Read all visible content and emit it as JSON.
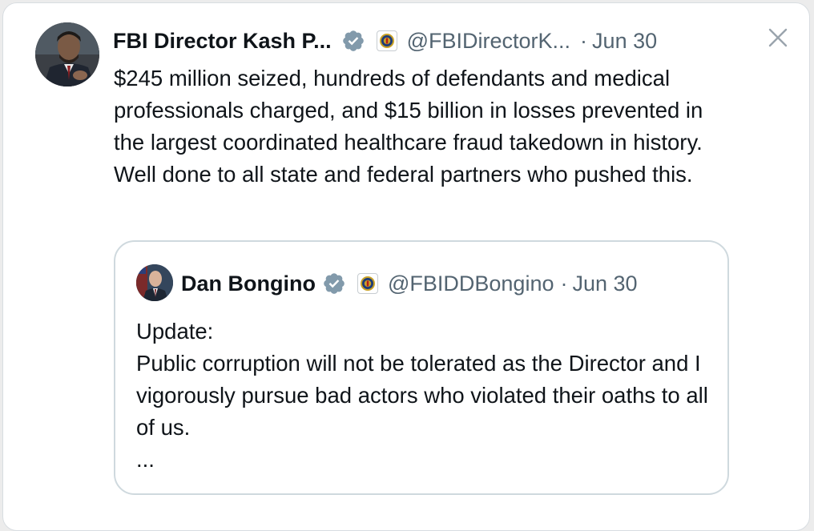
{
  "tweet": {
    "author_name": "FBI Director Kash P...",
    "handle": "@FBIDirectorK...",
    "separator": "·",
    "date": "Jun 30",
    "text": "$245 million seized, hundreds of defendants and medical professionals charged, and $15 billion in losses prevented in the largest coordinated healthcare fraud takedown in history. Well done to all state and federal partners who pushed this."
  },
  "quoted_tweet": {
    "author_name": "Dan Bongino",
    "handle": "@FBIDDBongino",
    "separator": "·",
    "date": "Jun 30",
    "lines": [
      "Update:",
      "Public corruption will not be tolerated as the Director and I vigorously pursue bad actors who violated their oaths to all of us.",
      "..."
    ]
  },
  "icons": {
    "verified": "verified-badge-icon",
    "org": "fbi-seal-icon",
    "close": "close-icon"
  },
  "colors": {
    "text": "#0f1419",
    "secondary": "#536471",
    "verified_badge": "#829aab",
    "border": "#cfd9de"
  }
}
